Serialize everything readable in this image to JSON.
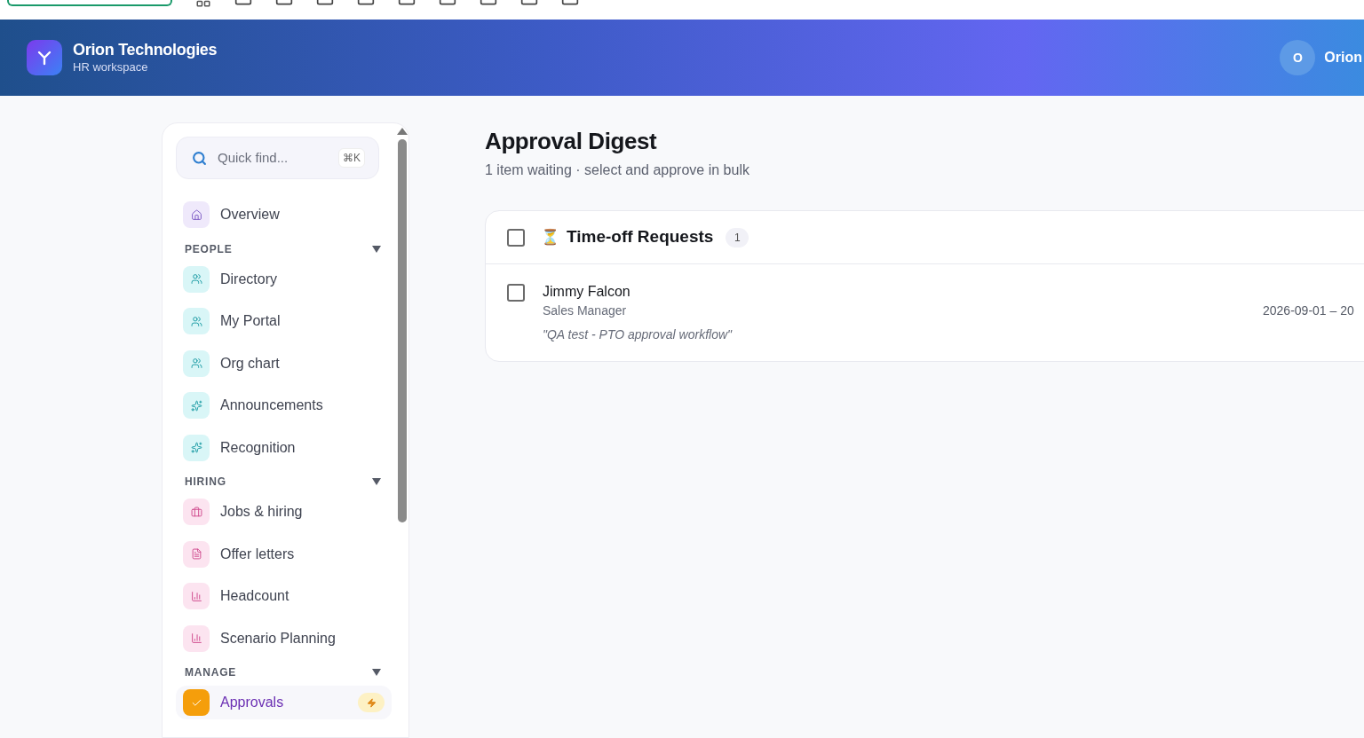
{
  "header": {
    "title": "Orion Technologies",
    "subtitle": "HR workspace",
    "user": {
      "initial": "O",
      "name": "Orion"
    }
  },
  "sidebar": {
    "search": {
      "placeholder": "Quick find...",
      "shortcut": "⌘K"
    },
    "top_items": [
      {
        "label": "Overview",
        "kind": "home",
        "selected": false
      }
    ],
    "sections": [
      {
        "title": "PEOPLE",
        "expanded": true,
        "items": [
          {
            "label": "Directory",
            "kind": "people",
            "selected": false
          },
          {
            "label": "My Portal",
            "kind": "people",
            "selected": false
          },
          {
            "label": "Org chart",
            "kind": "people",
            "selected": false
          },
          {
            "label": "Announcements",
            "kind": "sparkle",
            "selected": false
          },
          {
            "label": "Recognition",
            "kind": "sparkle",
            "selected": false
          }
        ]
      },
      {
        "title": "HIRING",
        "expanded": true,
        "items": [
          {
            "label": "Jobs & hiring",
            "kind": "briefcase",
            "selected": false
          },
          {
            "label": "Offer letters",
            "kind": "document",
            "selected": false
          },
          {
            "label": "Headcount",
            "kind": "chart",
            "selected": false
          },
          {
            "label": "Scenario Planning",
            "kind": "chart",
            "selected": false
          }
        ]
      },
      {
        "title": "MANAGE",
        "expanded": true,
        "items": [
          {
            "label": "Approvals",
            "kind": "check",
            "selected": true,
            "alert": true
          }
        ]
      }
    ]
  },
  "main": {
    "title": "Approval Digest",
    "subtitle": "1 item waiting · select and approve in bulk",
    "groups": [
      {
        "icon": "⏳",
        "title": "Time-off Requests",
        "count": "1",
        "checked": false,
        "requests": [
          {
            "name": "Jimmy Falcon",
            "role": "Sales Manager",
            "note": "\"QA test - PTO approval workflow\"",
            "dates": "2026-09-01 – 20",
            "checked": false
          }
        ]
      }
    ]
  }
}
